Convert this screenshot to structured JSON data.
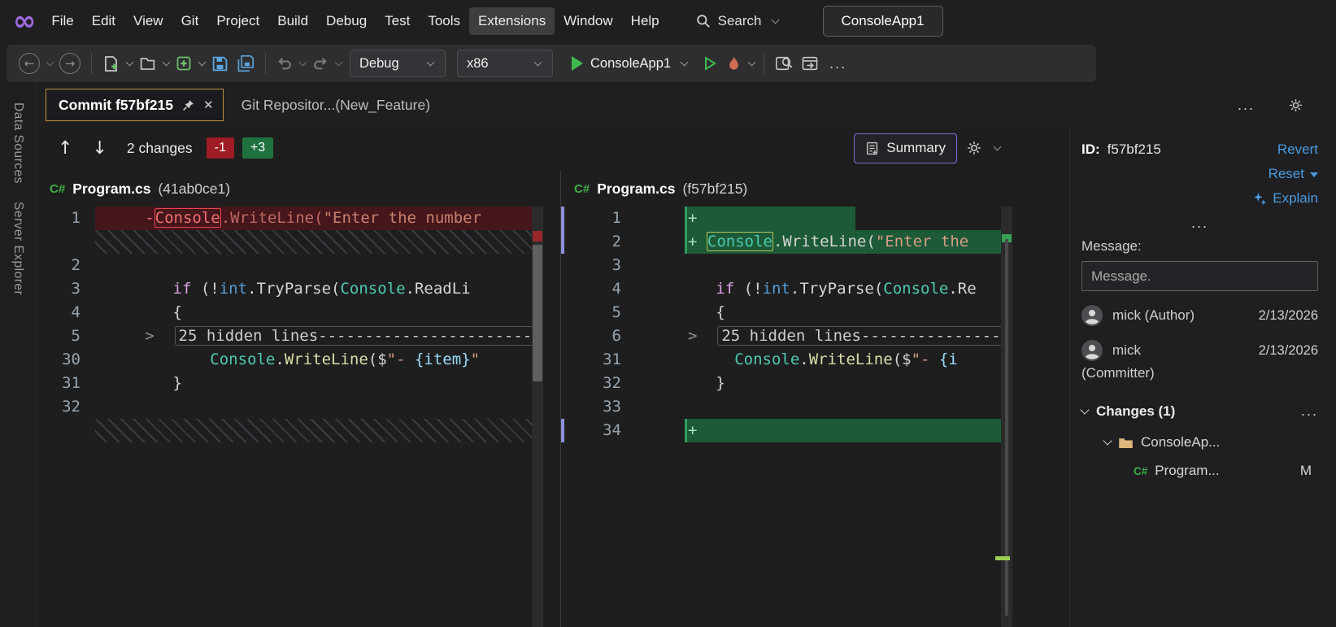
{
  "window": {
    "menus": [
      "File",
      "Edit",
      "View",
      "Git",
      "Project",
      "Build",
      "Debug",
      "Test",
      "Tools",
      "Extensions",
      "Window",
      "Help"
    ],
    "highlighted_menu": "Extensions",
    "search_label": "Search",
    "project_badge": "ConsoleApp1"
  },
  "toolbar": {
    "config": "Debug",
    "platform": "x86",
    "run_label": "ConsoleApp1",
    "overflow": "..."
  },
  "tab_bar": {
    "tabs": [
      {
        "label": "Commit f57bf215",
        "active": true
      },
      {
        "label": "Git Repositor...(New_Feature)",
        "active": false
      }
    ],
    "overflow": "..."
  },
  "diff_toolbar": {
    "changes": "2 changes",
    "removed": "-1",
    "added": "+3",
    "summary": "Summary"
  },
  "left_pane": {
    "file": "Program.cs",
    "ref": "(41ab0ce1)",
    "rows": [
      {
        "num": "1",
        "kind": "del",
        "segs": [
          {
            "t": "     ",
            "c": ""
          },
          {
            "t": "-",
            "c": "sign-del"
          },
          {
            "t": "Console",
            "c": "boxed-del"
          },
          {
            "t": ".WriteLine(",
            "c": "del-code"
          },
          {
            "t": "\"Enter the number",
            "c": "del-str"
          }
        ]
      },
      {
        "kind": "hatch"
      },
      {
        "num": "2",
        "kind": "code",
        "segs": []
      },
      {
        "num": "3",
        "kind": "code",
        "segs": [
          {
            "t": "        ",
            "c": ""
          },
          {
            "t": "if",
            "c": "kw"
          },
          {
            "t": " (!",
            "c": ""
          },
          {
            "t": "int",
            "c": "ty"
          },
          {
            "t": ".TryParse(",
            "c": ""
          },
          {
            "t": "Console",
            "c": "cls"
          },
          {
            "t": ".ReadLi",
            "c": ""
          }
        ]
      },
      {
        "num": "4",
        "kind": "code",
        "segs": [
          {
            "t": "        {",
            "c": ""
          }
        ]
      },
      {
        "num": "5",
        "kind": "code",
        "segs": [
          {
            "t": "     ",
            "c": ""
          },
          {
            "t": ">",
            "c": "fold"
          },
          {
            "t": "  ",
            "c": ""
          },
          {
            "t": "25 hidden lines-----------------------",
            "c": "fold-box"
          }
        ]
      },
      {
        "num": "30",
        "kind": "code",
        "segs": [
          {
            "t": "            ",
            "c": ""
          },
          {
            "t": "Console",
            "c": "cls"
          },
          {
            "t": ".",
            "c": ""
          },
          {
            "t": "WriteLine",
            "c": "m"
          },
          {
            "t": "($",
            "c": ""
          },
          {
            "t": "\"- ",
            "c": "str"
          },
          {
            "t": "{item}",
            "c": "var"
          },
          {
            "t": "\"",
            "c": "str"
          }
        ]
      },
      {
        "num": "31",
        "kind": "code",
        "segs": [
          {
            "t": "        }",
            "c": ""
          }
        ]
      },
      {
        "num": "32",
        "kind": "code",
        "segs": []
      },
      {
        "kind": "hatch"
      }
    ]
  },
  "right_pane": {
    "file": "Program.cs",
    "ref": "(f57bf215)",
    "rows": [
      {
        "num": "1",
        "kind": "addhalf",
        "bar": true,
        "segs": [
          {
            "t": "+",
            "c": "sign-add"
          }
        ]
      },
      {
        "num": "2",
        "kind": "add",
        "bar": true,
        "segs": [
          {
            "t": "+",
            "c": "sign-add"
          },
          {
            "t": " ",
            "c": ""
          },
          {
            "t": "Console",
            "c": "boxed-add"
          },
          {
            "t": ".WriteLine(",
            "c": ""
          },
          {
            "t": "\"Enter the",
            "c": "str"
          }
        ]
      },
      {
        "num": "3",
        "kind": "code",
        "segs": []
      },
      {
        "num": "4",
        "kind": "code",
        "segs": [
          {
            "t": "   ",
            "c": ""
          },
          {
            "t": "if",
            "c": "kw"
          },
          {
            "t": " (!",
            "c": ""
          },
          {
            "t": "int",
            "c": "ty"
          },
          {
            "t": ".TryParse(",
            "c": ""
          },
          {
            "t": "Console",
            "c": "cls"
          },
          {
            "t": ".Re",
            "c": ""
          }
        ]
      },
      {
        "num": "5",
        "kind": "code",
        "segs": [
          {
            "t": "   {",
            "c": ""
          }
        ]
      },
      {
        "num": "6",
        "kind": "code",
        "segs": [
          {
            "t": ">",
            "c": "fold"
          },
          {
            "t": "  ",
            "c": ""
          },
          {
            "t": "25 hidden lines----------------",
            "c": "fold-box"
          }
        ]
      },
      {
        "num": "31",
        "kind": "code",
        "segs": [
          {
            "t": "     ",
            "c": ""
          },
          {
            "t": "Console",
            "c": "cls"
          },
          {
            "t": ".",
            "c": ""
          },
          {
            "t": "WriteLine",
            "c": "m"
          },
          {
            "t": "($",
            "c": ""
          },
          {
            "t": "\"- ",
            "c": "str"
          },
          {
            "t": "{i",
            "c": "var"
          }
        ]
      },
      {
        "num": "32",
        "kind": "code",
        "segs": [
          {
            "t": "   }",
            "c": ""
          }
        ]
      },
      {
        "num": "33",
        "kind": "code",
        "segs": []
      },
      {
        "num": "34",
        "kind": "add",
        "bar": true,
        "segs": [
          {
            "t": "+",
            "c": "sign-add"
          }
        ]
      }
    ]
  },
  "details": {
    "id_label": "ID:",
    "id": "f57bf215",
    "revert": "Revert",
    "reset": "Reset",
    "explain": "Explain",
    "more": "...",
    "message_label": "Message:",
    "message": "Message.",
    "people": [
      {
        "name": "mick (Author)",
        "date": "2/13/2026",
        "role": ""
      },
      {
        "name": "mick",
        "date": "2/13/2026",
        "role": "(Committer)"
      }
    ],
    "changes_header": "Changes (1)",
    "changes_more": "...",
    "folder": "ConsoleAp...",
    "file": "Program...",
    "status": "M"
  },
  "side_tabs": [
    "Data Sources",
    "Server Explorer"
  ],
  "icons": {
    "csharp": "C#",
    "logo": "∞",
    "back": "←",
    "forward": "→",
    "up": "↑",
    "down": "↓",
    "close": "✕"
  }
}
